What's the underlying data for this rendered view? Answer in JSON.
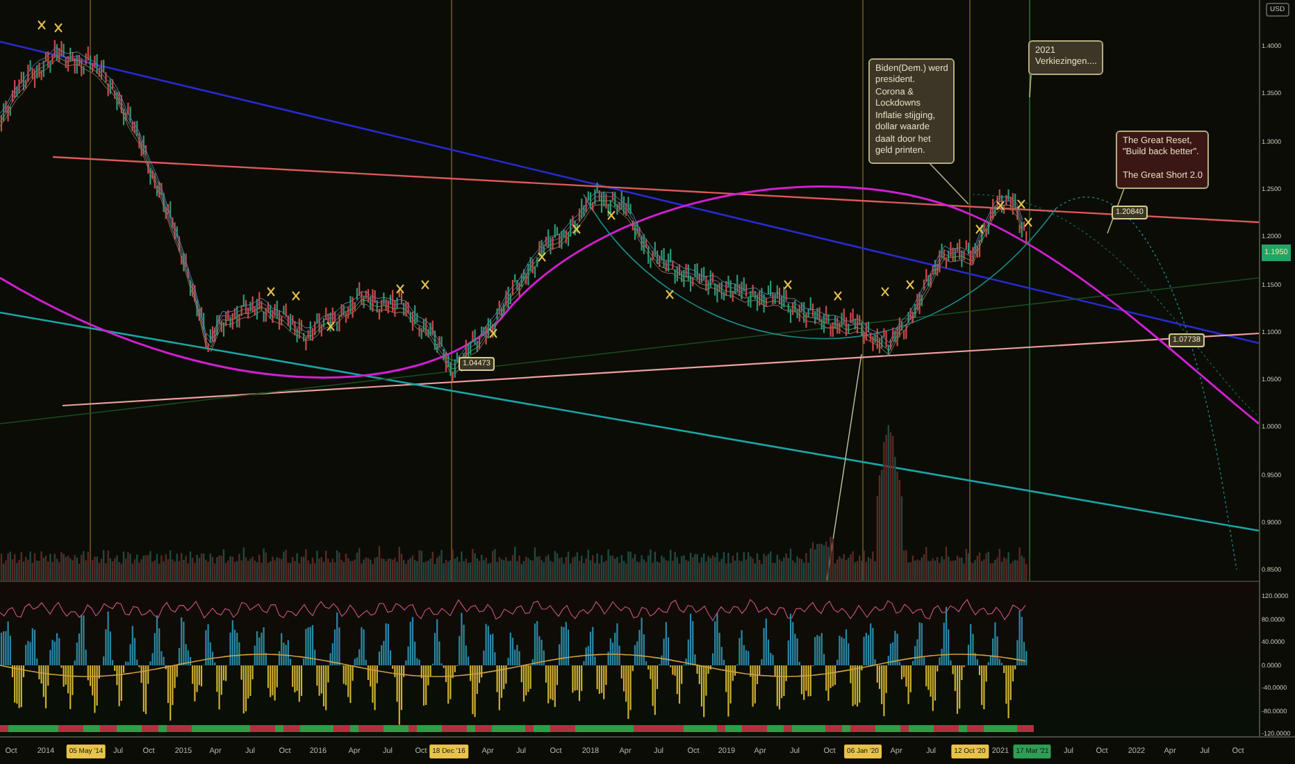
{
  "price_axis": {
    "unit": "USD",
    "labels": [
      "1.4000",
      "1.3500",
      "1.3000",
      "1.2500",
      "1.2000",
      "1.1500",
      "1.1000",
      "1.0500",
      "1.0000",
      "0.9500",
      "0.9000",
      "0.8500"
    ]
  },
  "last_price": {
    "value": "1.1950",
    "color": "#26a269"
  },
  "oscillator_axis": {
    "labels": [
      "120.0000",
      "80.0000",
      "40.0000",
      "0.0000",
      "-40.0000",
      "-80.0000",
      "-120.0000"
    ]
  },
  "time_axis": {
    "labels": [
      {
        "text": "Oct",
        "kind": "tick"
      },
      {
        "text": "2014",
        "kind": "tick"
      },
      {
        "text": "05 May '14",
        "kind": "marker",
        "color": "#e8c34a"
      },
      {
        "text": "Jul",
        "kind": "tick"
      },
      {
        "text": "Oct",
        "kind": "tick"
      },
      {
        "text": "2015",
        "kind": "tick"
      },
      {
        "text": "Apr",
        "kind": "tick"
      },
      {
        "text": "Jul",
        "kind": "tick"
      },
      {
        "text": "Oct",
        "kind": "tick"
      },
      {
        "text": "2016",
        "kind": "tick"
      },
      {
        "text": "Apr",
        "kind": "tick"
      },
      {
        "text": "Jul",
        "kind": "tick"
      },
      {
        "text": "Oct",
        "kind": "tick"
      },
      {
        "text": "18 Dec '16",
        "kind": "marker",
        "color": "#e8c34a"
      },
      {
        "text": "Apr",
        "kind": "tick"
      },
      {
        "text": "Jul",
        "kind": "tick"
      },
      {
        "text": "Oct",
        "kind": "tick"
      },
      {
        "text": "2018",
        "kind": "tick"
      },
      {
        "text": "Apr",
        "kind": "tick"
      },
      {
        "text": "Jul",
        "kind": "tick"
      },
      {
        "text": "Oct",
        "kind": "tick"
      },
      {
        "text": "2019",
        "kind": "tick"
      },
      {
        "text": "Apr",
        "kind": "tick"
      },
      {
        "text": "Jul",
        "kind": "tick"
      },
      {
        "text": "Oct",
        "kind": "tick"
      },
      {
        "text": "06 Jan '20",
        "kind": "marker",
        "color": "#e8c34a"
      },
      {
        "text": "Apr",
        "kind": "tick"
      },
      {
        "text": "Jul",
        "kind": "tick"
      },
      {
        "text": "12 Oct '20",
        "kind": "marker",
        "color": "#e8c34a"
      },
      {
        "text": "2021",
        "kind": "tick"
      },
      {
        "text": "17 Mar '21",
        "kind": "marker",
        "color": "#2e9e55"
      },
      {
        "text": "Jul",
        "kind": "tick"
      },
      {
        "text": "Oct",
        "kind": "tick"
      },
      {
        "text": "2022",
        "kind": "tick"
      },
      {
        "text": "Apr",
        "kind": "tick"
      },
      {
        "text": "Jul",
        "kind": "tick"
      },
      {
        "text": "Oct",
        "kind": "tick"
      }
    ]
  },
  "callouts": [
    {
      "text": "Biden(Dem.) werd\npresident.\nCorona &\nLockdowns\nInflatie stijging,\ndollar waarde\ndaalt door het\ngeld printen.",
      "color": "#3b3626"
    },
    {
      "text": "2021\nVerkiezingen....",
      "color": "#3b3626"
    },
    {
      "text": "The Great Reset,\n\"Build back better\".\n\nThe Great Short 2.0",
      "color": "#3a1714"
    }
  ],
  "price_labels": [
    "1.20840",
    "1.04473",
    "1.07738"
  ]
}
